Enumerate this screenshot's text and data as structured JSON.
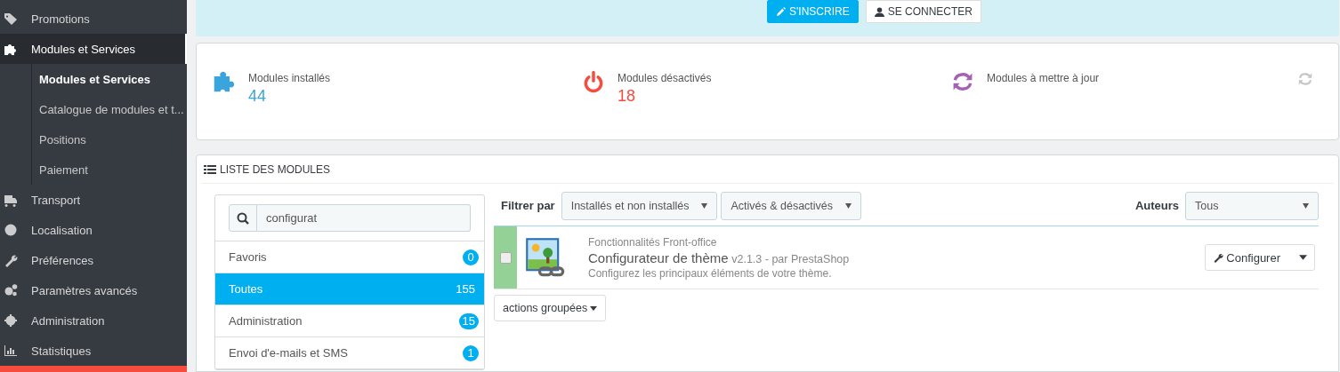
{
  "sidebar": {
    "items": [
      {
        "label": "Promotions",
        "selected": false
      },
      {
        "label": "Modules et Services",
        "selected": true,
        "children": [
          {
            "label": "Modules et Services",
            "selected": true
          },
          {
            "label": "Catalogue de modules et t...",
            "selected": false
          },
          {
            "label": "Positions",
            "selected": false
          },
          {
            "label": "Paiement",
            "selected": false
          }
        ]
      },
      {
        "label": "Transport",
        "selected": false
      },
      {
        "label": "Localisation",
        "selected": false
      },
      {
        "label": "Préférences",
        "selected": false
      },
      {
        "label": "Paramètres avancés",
        "selected": false
      },
      {
        "label": "Administration",
        "selected": false
      },
      {
        "label": "Statistiques",
        "selected": false
      }
    ]
  },
  "banner": {
    "buttons": [
      {
        "label": "S'INSCRIRE",
        "kind": "primary"
      },
      {
        "label": "SE CONNECTER",
        "kind": "default"
      }
    ]
  },
  "stats": [
    {
      "label": "Modules installés",
      "value": "44",
      "color": "#3aa4dd"
    },
    {
      "label": "Modules désactivés",
      "value": "18",
      "color": "#f54c3e"
    },
    {
      "label": "Modules à mettre à jour",
      "color": "#a463b1"
    }
  ],
  "module_list": {
    "title": "LISTE DES MODULES",
    "search": {
      "value": "configurat"
    },
    "categories": [
      {
        "label": "Favoris",
        "count": "0",
        "selected": false
      },
      {
        "label": "Toutes",
        "count": "155",
        "selected": true
      },
      {
        "label": "Administration",
        "count": "15",
        "selected": false
      },
      {
        "label": "Envoi d'e-mails et SMS",
        "count": "1",
        "selected": false
      }
    ],
    "filter_label": "Filtrer par",
    "filters": [
      "Installés et non installés",
      "Activés & désactivés"
    ],
    "authors_label": "Auteurs",
    "authors": "Tous",
    "modules": [
      {
        "category": "Fonctionnalités Front-office",
        "name": "Configurateur de thème",
        "meta": "v2.1.3 - par PrestaShop",
        "description": "Configurez les principaux éléments de votre thème.",
        "checked": false,
        "action": "Configurer"
      }
    ],
    "bulk_button": "actions groupées"
  }
}
